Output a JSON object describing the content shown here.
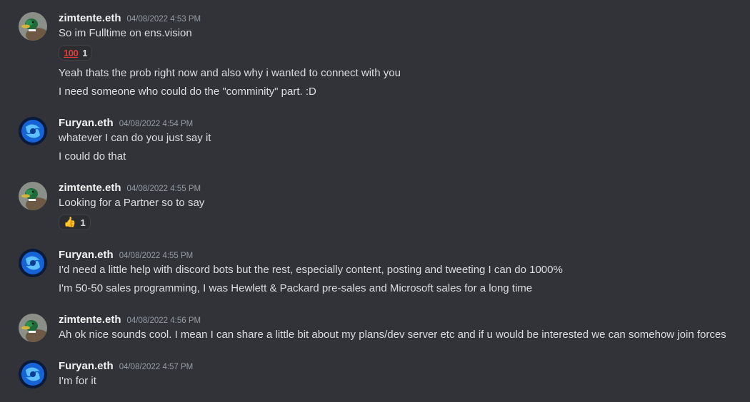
{
  "colors": {
    "background": "#313338",
    "username": "#f2f3f5",
    "timestamp": "#949ba4",
    "text": "#dbdee1",
    "reaction_bg": "#2b2d31"
  },
  "messages": [
    {
      "author": "zimtente.eth",
      "avatar": "duck-avatar",
      "timestamp": "04/08/2022 4:53 PM",
      "lines": [
        "So im Fulltime on ens.vision"
      ],
      "reaction": {
        "emoji": "hundred-points-icon",
        "glyph": "100",
        "count": "1"
      },
      "more_lines": [
        "Yeah thats the prob right now and also why i wanted to connect with  you",
        "I need someone who could do the \"comminity\" part. :D"
      ]
    },
    {
      "author": "Furyan.eth",
      "avatar": "blue-swirl-avatar",
      "timestamp": "04/08/2022 4:54 PM",
      "lines": [
        "whatever I can do you just say it",
        "I could do that"
      ]
    },
    {
      "author": "zimtente.eth",
      "avatar": "duck-avatar",
      "timestamp": "04/08/2022 4:55 PM",
      "lines": [
        "Looking for a Partner so to say"
      ],
      "reaction": {
        "emoji": "thumbs-up-icon",
        "glyph": "👍",
        "count": "1"
      }
    },
    {
      "author": "Furyan.eth",
      "avatar": "blue-swirl-avatar",
      "timestamp": "04/08/2022 4:55 PM",
      "lines": [
        "I'd need a little help with discord bots but the rest, especially content, posting and tweeting I can do 1000%",
        "I'm 50-50 sales programming, I was Hewlett & Packard pre-sales and Microsoft sales for a long time"
      ]
    },
    {
      "author": "zimtente.eth",
      "avatar": "duck-avatar",
      "timestamp": "04/08/2022 4:56 PM",
      "lines": [
        "Ah ok nice sounds cool. I mean I can share a little bit about my plans/dev server etc and if u would be interested we can somehow join forces"
      ]
    },
    {
      "author": "Furyan.eth",
      "avatar": "blue-swirl-avatar",
      "timestamp": "04/08/2022 4:57 PM",
      "lines": [
        "I'm for it"
      ]
    }
  ]
}
